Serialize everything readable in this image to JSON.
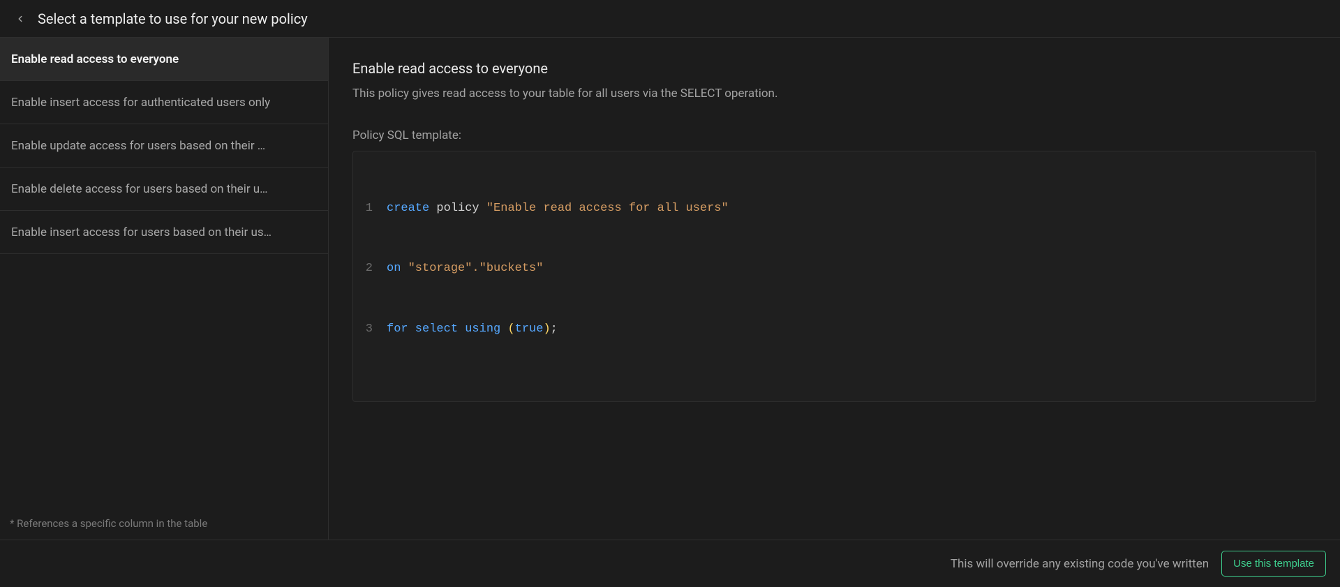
{
  "header": {
    "title": "Select a template to use for your new policy"
  },
  "sidebar": {
    "templates": [
      "Enable read access to everyone",
      "Enable insert access for authenticated users only",
      "Enable update access for users based on their …",
      "Enable delete access for users based on their u…",
      "Enable insert access for users based on their us…"
    ],
    "selected_index": 0,
    "footnote": "* References a specific column in the table"
  },
  "detail": {
    "title": "Enable read access to everyone",
    "description": "This policy gives read access to your table for all users via the SELECT operation.",
    "sql_label": "Policy SQL template:",
    "code": {
      "line1": {
        "kw": "create",
        "rest": " policy ",
        "str": "\"Enable read access for all users\""
      },
      "line2": {
        "kw": "on",
        "space": " ",
        "str": "\"storage\".\"buckets\""
      },
      "line3": {
        "for": "for",
        "select": " select ",
        "using": "using ",
        "open": "(",
        "bool": "true",
        "close": ")",
        "semi": ";"
      }
    }
  },
  "footer": {
    "override_text": "This will override any existing code you've written",
    "button_label": "Use this template"
  }
}
